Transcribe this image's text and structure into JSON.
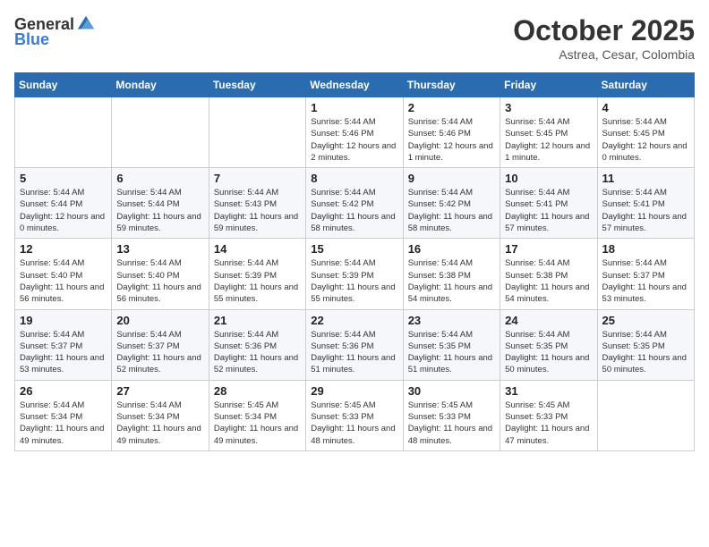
{
  "logo": {
    "text_general": "General",
    "text_blue": "Blue"
  },
  "header": {
    "month": "October 2025",
    "location": "Astrea, Cesar, Colombia"
  },
  "weekdays": [
    "Sunday",
    "Monday",
    "Tuesday",
    "Wednesday",
    "Thursday",
    "Friday",
    "Saturday"
  ],
  "weeks": [
    [
      {
        "day": "",
        "sunrise": "",
        "sunset": "",
        "daylight": ""
      },
      {
        "day": "",
        "sunrise": "",
        "sunset": "",
        "daylight": ""
      },
      {
        "day": "",
        "sunrise": "",
        "sunset": "",
        "daylight": ""
      },
      {
        "day": "1",
        "sunrise": "Sunrise: 5:44 AM",
        "sunset": "Sunset: 5:46 PM",
        "daylight": "Daylight: 12 hours and 2 minutes."
      },
      {
        "day": "2",
        "sunrise": "Sunrise: 5:44 AM",
        "sunset": "Sunset: 5:46 PM",
        "daylight": "Daylight: 12 hours and 1 minute."
      },
      {
        "day": "3",
        "sunrise": "Sunrise: 5:44 AM",
        "sunset": "Sunset: 5:45 PM",
        "daylight": "Daylight: 12 hours and 1 minute."
      },
      {
        "day": "4",
        "sunrise": "Sunrise: 5:44 AM",
        "sunset": "Sunset: 5:45 PM",
        "daylight": "Daylight: 12 hours and 0 minutes."
      }
    ],
    [
      {
        "day": "5",
        "sunrise": "Sunrise: 5:44 AM",
        "sunset": "Sunset: 5:44 PM",
        "daylight": "Daylight: 12 hours and 0 minutes."
      },
      {
        "day": "6",
        "sunrise": "Sunrise: 5:44 AM",
        "sunset": "Sunset: 5:44 PM",
        "daylight": "Daylight: 11 hours and 59 minutes."
      },
      {
        "day": "7",
        "sunrise": "Sunrise: 5:44 AM",
        "sunset": "Sunset: 5:43 PM",
        "daylight": "Daylight: 11 hours and 59 minutes."
      },
      {
        "day": "8",
        "sunrise": "Sunrise: 5:44 AM",
        "sunset": "Sunset: 5:42 PM",
        "daylight": "Daylight: 11 hours and 58 minutes."
      },
      {
        "day": "9",
        "sunrise": "Sunrise: 5:44 AM",
        "sunset": "Sunset: 5:42 PM",
        "daylight": "Daylight: 11 hours and 58 minutes."
      },
      {
        "day": "10",
        "sunrise": "Sunrise: 5:44 AM",
        "sunset": "Sunset: 5:41 PM",
        "daylight": "Daylight: 11 hours and 57 minutes."
      },
      {
        "day": "11",
        "sunrise": "Sunrise: 5:44 AM",
        "sunset": "Sunset: 5:41 PM",
        "daylight": "Daylight: 11 hours and 57 minutes."
      }
    ],
    [
      {
        "day": "12",
        "sunrise": "Sunrise: 5:44 AM",
        "sunset": "Sunset: 5:40 PM",
        "daylight": "Daylight: 11 hours and 56 minutes."
      },
      {
        "day": "13",
        "sunrise": "Sunrise: 5:44 AM",
        "sunset": "Sunset: 5:40 PM",
        "daylight": "Daylight: 11 hours and 56 minutes."
      },
      {
        "day": "14",
        "sunrise": "Sunrise: 5:44 AM",
        "sunset": "Sunset: 5:39 PM",
        "daylight": "Daylight: 11 hours and 55 minutes."
      },
      {
        "day": "15",
        "sunrise": "Sunrise: 5:44 AM",
        "sunset": "Sunset: 5:39 PM",
        "daylight": "Daylight: 11 hours and 55 minutes."
      },
      {
        "day": "16",
        "sunrise": "Sunrise: 5:44 AM",
        "sunset": "Sunset: 5:38 PM",
        "daylight": "Daylight: 11 hours and 54 minutes."
      },
      {
        "day": "17",
        "sunrise": "Sunrise: 5:44 AM",
        "sunset": "Sunset: 5:38 PM",
        "daylight": "Daylight: 11 hours and 54 minutes."
      },
      {
        "day": "18",
        "sunrise": "Sunrise: 5:44 AM",
        "sunset": "Sunset: 5:37 PM",
        "daylight": "Daylight: 11 hours and 53 minutes."
      }
    ],
    [
      {
        "day": "19",
        "sunrise": "Sunrise: 5:44 AM",
        "sunset": "Sunset: 5:37 PM",
        "daylight": "Daylight: 11 hours and 53 minutes."
      },
      {
        "day": "20",
        "sunrise": "Sunrise: 5:44 AM",
        "sunset": "Sunset: 5:37 PM",
        "daylight": "Daylight: 11 hours and 52 minutes."
      },
      {
        "day": "21",
        "sunrise": "Sunrise: 5:44 AM",
        "sunset": "Sunset: 5:36 PM",
        "daylight": "Daylight: 11 hours and 52 minutes."
      },
      {
        "day": "22",
        "sunrise": "Sunrise: 5:44 AM",
        "sunset": "Sunset: 5:36 PM",
        "daylight": "Daylight: 11 hours and 51 minutes."
      },
      {
        "day": "23",
        "sunrise": "Sunrise: 5:44 AM",
        "sunset": "Sunset: 5:35 PM",
        "daylight": "Daylight: 11 hours and 51 minutes."
      },
      {
        "day": "24",
        "sunrise": "Sunrise: 5:44 AM",
        "sunset": "Sunset: 5:35 PM",
        "daylight": "Daylight: 11 hours and 50 minutes."
      },
      {
        "day": "25",
        "sunrise": "Sunrise: 5:44 AM",
        "sunset": "Sunset: 5:35 PM",
        "daylight": "Daylight: 11 hours and 50 minutes."
      }
    ],
    [
      {
        "day": "26",
        "sunrise": "Sunrise: 5:44 AM",
        "sunset": "Sunset: 5:34 PM",
        "daylight": "Daylight: 11 hours and 49 minutes."
      },
      {
        "day": "27",
        "sunrise": "Sunrise: 5:44 AM",
        "sunset": "Sunset: 5:34 PM",
        "daylight": "Daylight: 11 hours and 49 minutes."
      },
      {
        "day": "28",
        "sunrise": "Sunrise: 5:45 AM",
        "sunset": "Sunset: 5:34 PM",
        "daylight": "Daylight: 11 hours and 49 minutes."
      },
      {
        "day": "29",
        "sunrise": "Sunrise: 5:45 AM",
        "sunset": "Sunset: 5:33 PM",
        "daylight": "Daylight: 11 hours and 48 minutes."
      },
      {
        "day": "30",
        "sunrise": "Sunrise: 5:45 AM",
        "sunset": "Sunset: 5:33 PM",
        "daylight": "Daylight: 11 hours and 48 minutes."
      },
      {
        "day": "31",
        "sunrise": "Sunrise: 5:45 AM",
        "sunset": "Sunset: 5:33 PM",
        "daylight": "Daylight: 11 hours and 47 minutes."
      },
      {
        "day": "",
        "sunrise": "",
        "sunset": "",
        "daylight": ""
      }
    ]
  ]
}
